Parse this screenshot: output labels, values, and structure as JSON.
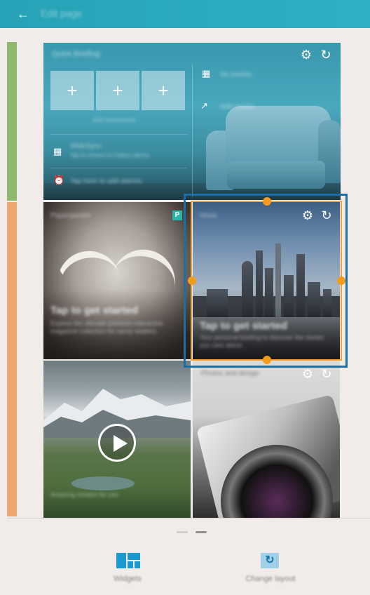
{
  "header": {
    "title": "Edit page",
    "back_icon": "arrow-left-icon"
  },
  "panels": {
    "quick_briefing": {
      "title": "Quick Briefing",
      "add_bookmark_label": "Add bookmarks",
      "slidedeck_title": "SlideSync",
      "slidedeck_subtitle": "Tap to connect to Galaxy device",
      "alarm_text": "Tap here to add alarms",
      "calendar_text": "No events",
      "stocks_text": "Add stocks"
    },
    "papergarden": {
      "title": "Papergarden",
      "headline": "Tap to get started",
      "description": "Explore the ultimate premium interactive magazine collection for savvy readers."
    },
    "news": {
      "title": "News",
      "headline": "Tap to get started",
      "description": "Your personal briefing to discover the stories you care about."
    },
    "video": {
      "caption": "Amazing content for you"
    },
    "photo": {
      "title": "Photos and design"
    }
  },
  "bottom": {
    "widgets_label": "Widgets",
    "change_layout_label": "Change layout"
  },
  "colors": {
    "accent": "#2bacc0",
    "selection_border": "#1b6fa4",
    "handle": "#f29b1e"
  }
}
